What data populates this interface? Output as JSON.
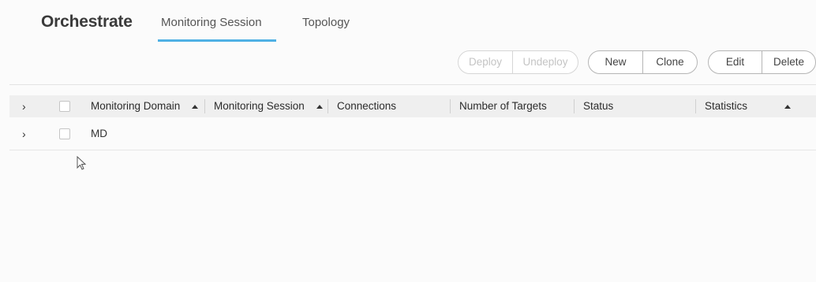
{
  "header": {
    "app_title": "Orchestrate",
    "tabs": [
      {
        "label": "Monitoring Session",
        "active": true
      },
      {
        "label": "Topology",
        "active": false
      }
    ]
  },
  "toolbar": {
    "deploy_label": "Deploy",
    "undeploy_label": "Undeploy",
    "new_label": "New",
    "clone_label": "Clone",
    "edit_label": "Edit",
    "delete_label": "Delete"
  },
  "table": {
    "columns": [
      {
        "label": "Monitoring Domain",
        "sortable": true
      },
      {
        "label": "Monitoring Session",
        "sortable": true
      },
      {
        "label": "Connections",
        "sortable": false
      },
      {
        "label": "Number of Targets",
        "sortable": false
      },
      {
        "label": "Status",
        "sortable": false
      },
      {
        "label": "Statistics",
        "sortable": false
      }
    ],
    "rows": [
      {
        "domain": "MD",
        "session": "",
        "connections": "",
        "targets": "",
        "status": "",
        "statistics": ""
      }
    ]
  },
  "colors": {
    "active_tab_underline": "#4fb0e4",
    "header_bg": "#efefef",
    "disabled_text": "#c4c4c4"
  },
  "icons": {
    "expand": "chevron-right-icon",
    "sort": "sort-up-icon",
    "pointer": "mouse-pointer-icon"
  }
}
